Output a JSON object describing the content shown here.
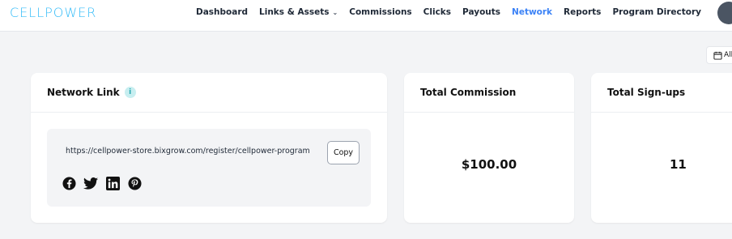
{
  "app": {
    "logo_text": "CELLPOWER"
  },
  "nav": {
    "items": [
      {
        "label": "Dashboard",
        "active": false
      },
      {
        "label": "Links & Assets",
        "active": false,
        "has_dropdown": true
      },
      {
        "label": "Commissions",
        "active": false
      },
      {
        "label": "Clicks",
        "active": false
      },
      {
        "label": "Payouts",
        "active": false
      },
      {
        "label": "Network",
        "active": true
      },
      {
        "label": "Reports",
        "active": false
      },
      {
        "label": "Program Directory",
        "active": false
      }
    ],
    "dropdown_icon": "chevron-down-icon"
  },
  "date_filter": {
    "label": "All-",
    "icon": "calendar-icon"
  },
  "network_card": {
    "title": "Network Link",
    "info_icon": "info-icon",
    "url": "https://cellpower-store.bixgrow.com/register/cellpower-program",
    "copy_label": "Copy",
    "socials": [
      "facebook-icon",
      "twitter-icon",
      "linkedin-icon",
      "pinterest-icon"
    ]
  },
  "commission_card": {
    "title": "Total Commission",
    "value": "$100.00"
  },
  "signups_card": {
    "title": "Total Sign-ups",
    "value": "11"
  },
  "colors": {
    "accent": "#3b82f6",
    "logo": "#38bdf8",
    "background": "#f3f4f6"
  }
}
